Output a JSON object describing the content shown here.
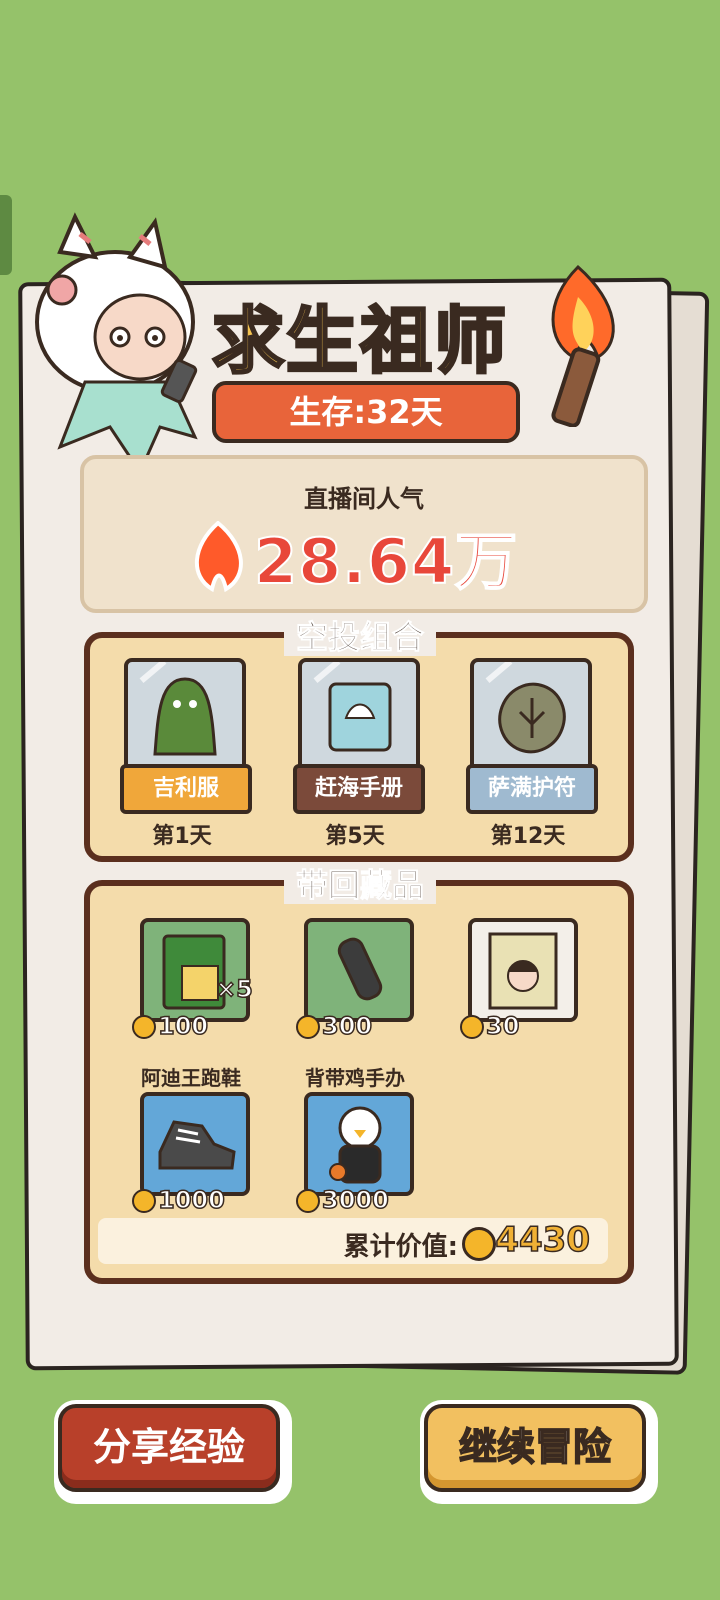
{
  "title": "求生祖师",
  "survive": "生存:32天",
  "popularity": {
    "label": "直播间人气",
    "value": "28.64万"
  },
  "airdrop": {
    "title": "空投组合",
    "items": [
      {
        "name": "吉利服",
        "day": "第1天",
        "label_color": "#f0a73a"
      },
      {
        "name": "赶海手册",
        "day": "第5天",
        "label_color": "#7b4a3a"
      },
      {
        "name": "萨满护符",
        "day": "第12天",
        "label_color": "#9fbad0"
      }
    ]
  },
  "collection": {
    "title": "带回藏品",
    "items": [
      {
        "name": "",
        "price": "100",
        "qty": "×5",
        "bg": "#7fb37a"
      },
      {
        "name": "",
        "price": "300",
        "qty": "",
        "bg": "#7fb37a"
      },
      {
        "name": "",
        "price": "30",
        "qty": "",
        "bg": "#f3efe9"
      },
      {
        "name": "阿迪王跑鞋",
        "price": "1000",
        "qty": "",
        "bg": "#63a7d8"
      },
      {
        "name": "背带鸡手办",
        "price": "3000",
        "qty": "",
        "bg": "#63a7d8"
      }
    ],
    "total_label": "累计价值:",
    "total_value": "4430"
  },
  "buttons": {
    "share": "分享经验",
    "continue": "继续冒险"
  }
}
